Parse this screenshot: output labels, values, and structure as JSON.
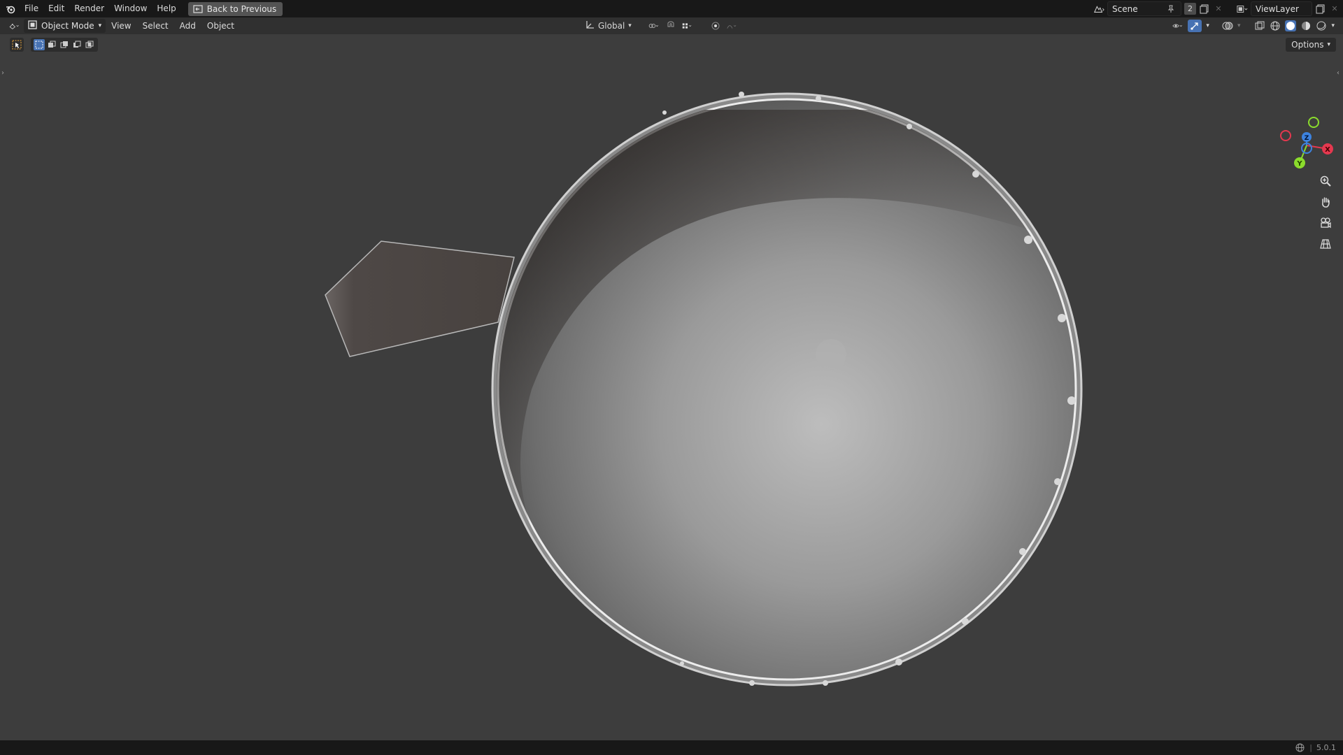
{
  "topbar": {
    "menus": [
      "File",
      "Edit",
      "Render",
      "Window",
      "Help"
    ],
    "back_label": "Back to Previous",
    "scene_name": "Scene",
    "user_count": "2",
    "view_layer": "ViewLayer"
  },
  "header": {
    "mode": "Object Mode",
    "menus": [
      "View",
      "Select",
      "Add",
      "Object"
    ],
    "transform_orientation": "Global"
  },
  "toolbar": {
    "options_label": "Options"
  },
  "gizmo": {
    "x_label": "X",
    "y_label": "Y",
    "z_label": "Z",
    "x_color": "#e5384f",
    "y_color": "#8bdc2c",
    "z_color": "#3d83e0"
  },
  "status": {
    "version": "5.0.1"
  }
}
